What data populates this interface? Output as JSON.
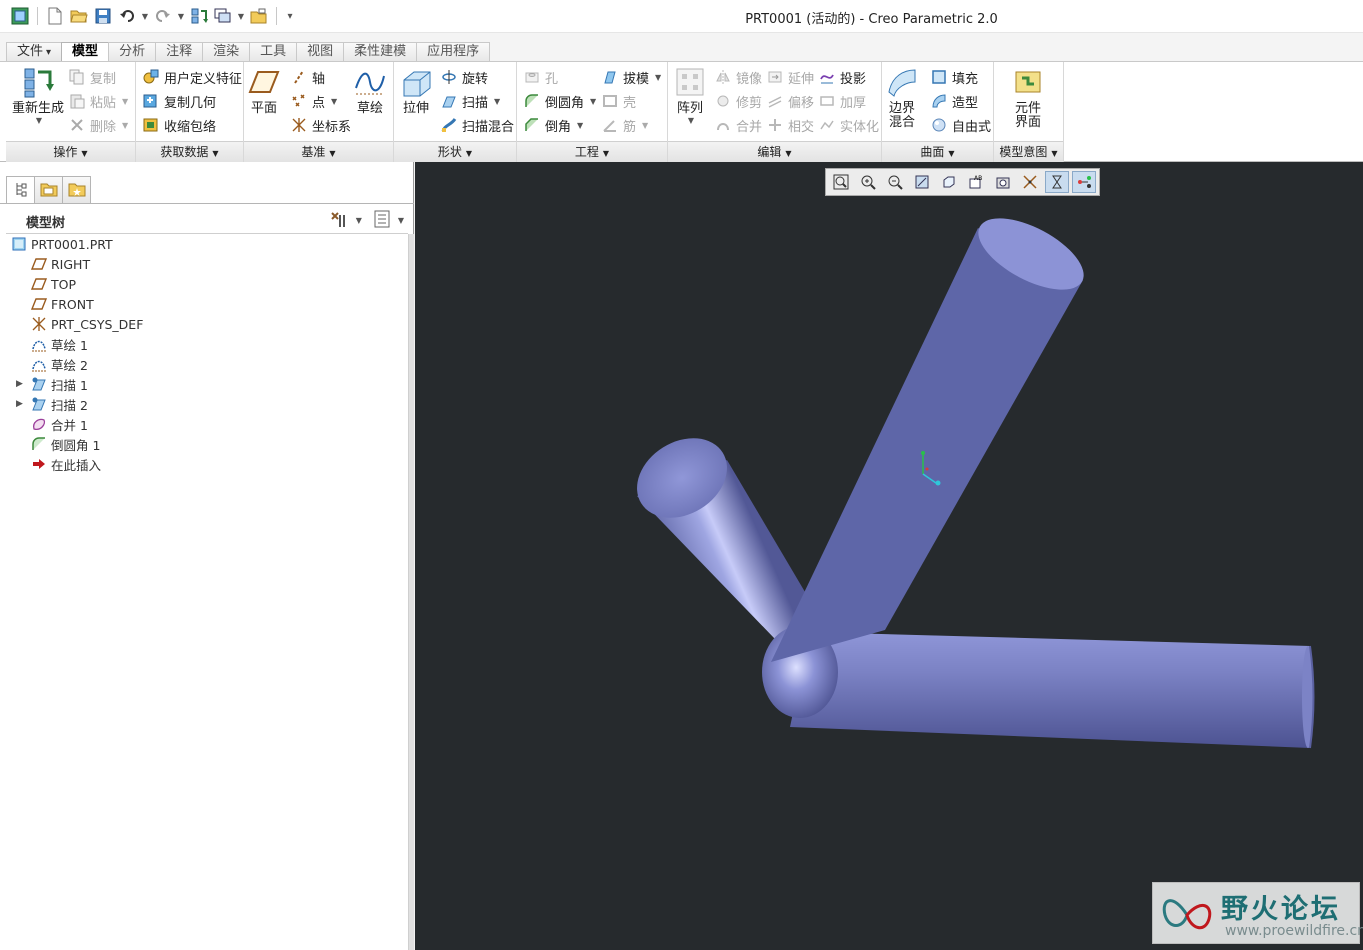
{
  "window": {
    "title": "PRT0001 (活动的) - Creo Parametric 2.0"
  },
  "quick_access": {
    "icons": [
      "app-icon",
      "new-icon",
      "open-icon",
      "save-icon",
      "undo-icon",
      "redo-icon",
      "regenerate-icon",
      "windows-icon",
      "close-window-icon",
      "customize-icon"
    ]
  },
  "tabs": [
    {
      "label": "文件",
      "dropdown": "▾"
    },
    {
      "label": "模型"
    },
    {
      "label": "分析"
    },
    {
      "label": "注释"
    },
    {
      "label": "渲染"
    },
    {
      "label": "工具"
    },
    {
      "label": "视图"
    },
    {
      "label": "柔性建模"
    },
    {
      "label": "应用程序"
    }
  ],
  "ribbon": {
    "operations": {
      "footer": "操作",
      "regenerate": "重新生成",
      "copy": "复制",
      "paste": "粘贴",
      "delete": "删除"
    },
    "get_data": {
      "footer": "获取数据",
      "user_defined_feature": "用户定义特征",
      "copy_geometry": "复制几何",
      "shrinkwrap": "收缩包络"
    },
    "datum": {
      "footer": "基准",
      "plane": "平面",
      "axis": "轴",
      "point": "点",
      "csys": "坐标系",
      "sketch": "草绘"
    },
    "shapes": {
      "footer": "形状",
      "extrude": "拉伸",
      "revolve": "旋转",
      "sweep": "扫描",
      "swept_blend": "扫描混合"
    },
    "engineering": {
      "footer": "工程",
      "hole": "孔",
      "round": "倒圆角",
      "chamfer": "倒角",
      "draft": "拔模",
      "shell": "壳",
      "rib": "筋"
    },
    "editing": {
      "footer": "编辑",
      "pattern": "阵列",
      "mirror": "镜像",
      "trim": "修剪",
      "merge": "合并",
      "extend": "延伸",
      "offset": "偏移",
      "intersect": "相交",
      "project": "投影",
      "thicken": "加厚",
      "solidify": "实体化"
    },
    "surfaces": {
      "footer": "曲面",
      "boundary_blend_line1": "边界",
      "boundary_blend_line2": "混合",
      "fill": "填充",
      "style": "造型",
      "freestyle": "自由式"
    },
    "model_intent": {
      "footer": "模型意图",
      "component_interface_line1": "元件",
      "component_interface_line2": "界面"
    }
  },
  "model_tree": {
    "title": "模型树",
    "items": [
      {
        "label": "PRT0001.PRT",
        "icon": "part-icon",
        "expandable": false
      },
      {
        "label": "RIGHT",
        "icon": "datum-plane-icon",
        "expandable": false
      },
      {
        "label": "TOP",
        "icon": "datum-plane-icon",
        "expandable": false
      },
      {
        "label": "FRONT",
        "icon": "datum-plane-icon",
        "expandable": false
      },
      {
        "label": "PRT_CSYS_DEF",
        "icon": "csys-icon",
        "expandable": false
      },
      {
        "label": "草绘 1",
        "icon": "sketch-icon",
        "expandable": false
      },
      {
        "label": "草绘 2",
        "icon": "sketch-icon",
        "expandable": false
      },
      {
        "label": "扫描 1",
        "icon": "sweep-icon",
        "expandable": true
      },
      {
        "label": "扫描 2",
        "icon": "sweep-icon",
        "expandable": true
      },
      {
        "label": "合并 1",
        "icon": "merge-icon",
        "expandable": false
      },
      {
        "label": "倒圆角 1",
        "icon": "round-icon",
        "expandable": false
      },
      {
        "label": "在此插入",
        "icon": "insert-here-icon",
        "expandable": false
      }
    ]
  },
  "viewport": {
    "background": "#262a2d",
    "model_color": "#7b82c4",
    "toolbar_icons": [
      "refit-icon",
      "zoom-in-icon",
      "zoom-out-icon",
      "repaint-icon",
      "display-style-icon",
      "saved-orientations-icon",
      "view-manager-icon",
      "perspective-icon",
      "datum-display-icon",
      "spin-center-icon",
      "annotation-display-icon"
    ]
  },
  "watermark": {
    "title": "野火论坛",
    "url": "www.proewildfire.cn"
  },
  "colors": {
    "accent_blue": "#2f6fb8",
    "tree_icon_brown": "#9a5b1e",
    "insert_arrow": "#c0181d"
  }
}
